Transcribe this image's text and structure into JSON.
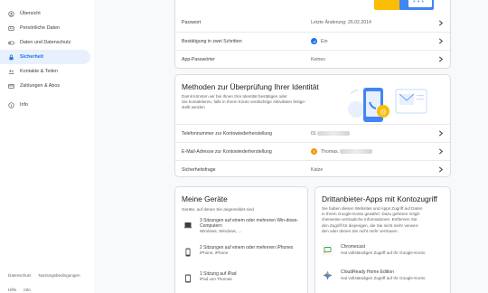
{
  "sidebar": {
    "items": [
      {
        "label": "Übersicht",
        "icon": "home-icon"
      },
      {
        "label": "Persönliche Daten",
        "icon": "person-card-icon"
      },
      {
        "label": "Daten und Datenschutz",
        "icon": "toggle-icon"
      },
      {
        "label": "Sicherheit",
        "icon": "lock-icon",
        "active": true
      },
      {
        "label": "Kontakte & Teilen",
        "icon": "people-icon"
      },
      {
        "label": "Zahlungen & Abos",
        "icon": "credit-card-icon"
      },
      {
        "label": "Info",
        "icon": "info-icon"
      }
    ],
    "footer": [
      "Datenschutz",
      "Nutzungsbedingungen"
    ],
    "footer2": [
      "Hilfe",
      "Info"
    ]
  },
  "signin": {
    "rows": [
      {
        "label": "Passwort",
        "value": "Letzte Änderung: 26.02.2014"
      },
      {
        "label": "Bestätigung in zwei Schritten",
        "value": "Ein"
      },
      {
        "label": "App-Passwörter",
        "value": "Keines"
      }
    ]
  },
  "identity": {
    "title": "Methoden zur Überprüfung Ihrer Identität",
    "description": "Damit könnten wir bei Ihnen überprüfen, ob Ihre Identität bestätigen oder Sie kontaktieren, falls in Ihrem Konto verdächtige Aktivitäten festgestellt werden",
    "desc_lines": [
      "Damit könnten wir bei Ihnen Ihre Identität bestätigen oder",
      "Sie kontaktieren, falls in Ihrem Konto verdächtige Aktivitäten festge-",
      "stellt werden"
    ],
    "rows": [
      {
        "label": "Telefonnummer zur Kontowiederherstellung",
        "value": "01"
      },
      {
        "label": "E-Mail-Adresse zur Kontowiederherstellung",
        "value": "Thomas."
      },
      {
        "label": "Sicherheitsfrage",
        "value": "Katze"
      }
    ]
  },
  "devices": {
    "title": "Meine Geräte",
    "subtitle": "Geräte, auf denen Sie angemeldet sind",
    "items": [
      {
        "title": "3 Sitzungen auf einem oder mehreren Win-dows-Computern",
        "sub": "Windows, Windows, ...",
        "icon": "laptop-icon"
      },
      {
        "title": "2 Sitzungen auf einem oder mehreren iPhones",
        "sub": "iPhone, iPhone",
        "icon": "phone-icon"
      },
      {
        "title": "1 Sitzung auf iPad",
        "sub": "iPad von Thomas",
        "icon": "tablet-icon"
      }
    ]
  },
  "thirdparty": {
    "title": "Drittanbieter-Apps mit Kontozugriff",
    "desc_lines": [
      "Sie haben diesen Websites und Apps Zugriff auf Daten",
      "in Ihrem Google-Konto gewährt. Dazu gehören mögli-",
      "cherweise vertrauliche Informationen. Entfernen Sie",
      "den Zugriff für diejenigen, die Sie nicht mehr verwen-",
      "den oder denen Sie nicht mehr vertrauen."
    ],
    "apps": [
      {
        "name": "Chromecast",
        "sub": "Hat vollständigen Zugriff auf Ihr Google-Konto",
        "icon": "chromecast-icon"
      },
      {
        "name": "CloudReady Home Edition",
        "sub": "Hat vollständigen Zugriff auf Ihr Google-Konto",
        "icon": "cloudready-icon"
      }
    ]
  },
  "colors": {
    "accent": "#1a73e8",
    "active_bg": "#e8f0fe",
    "warn": "#f29900",
    "illus_blue": "#4285f4",
    "illus_yellow": "#fbbc04"
  }
}
